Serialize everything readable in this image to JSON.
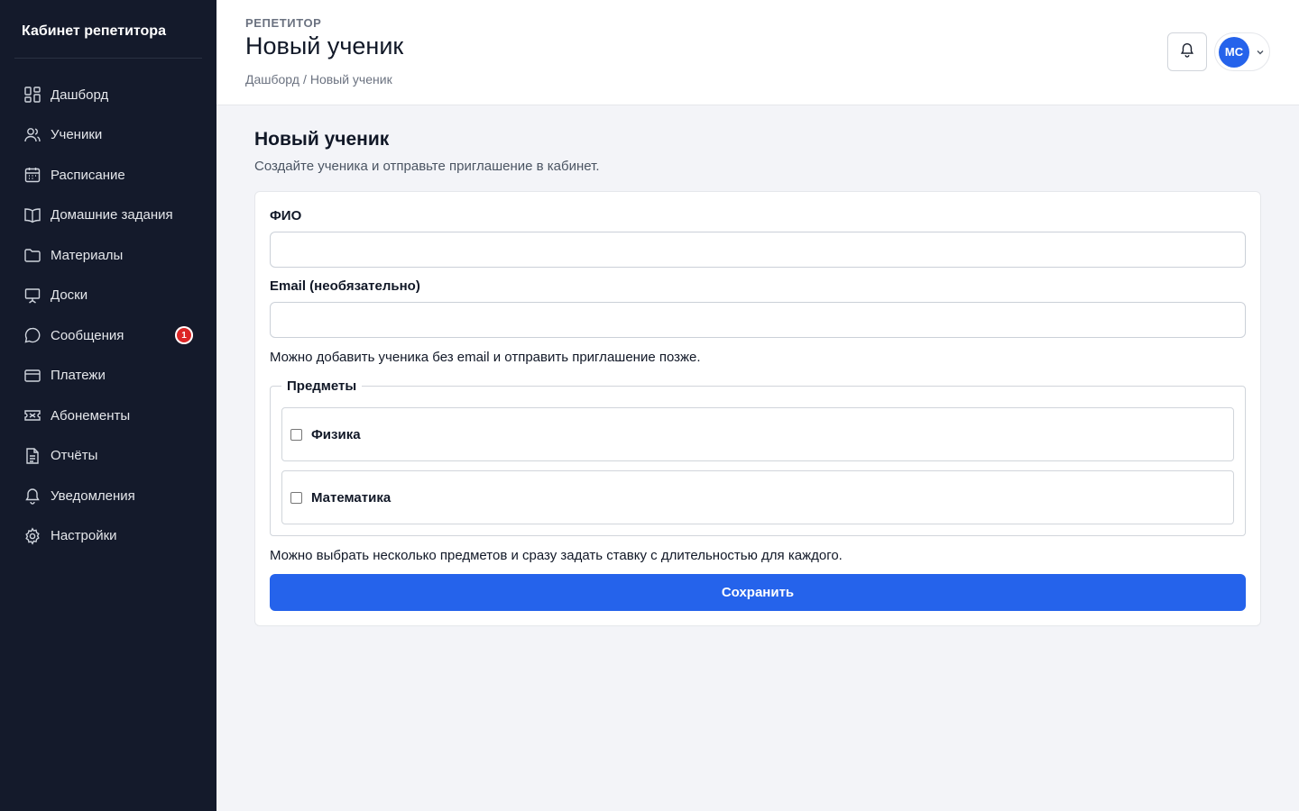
{
  "sidebar": {
    "brand": "Кабинет репетитора",
    "items": [
      {
        "label": "Дашборд",
        "icon": "dashboard-icon"
      },
      {
        "label": "Ученики",
        "icon": "users-icon"
      },
      {
        "label": "Расписание",
        "icon": "calendar-icon"
      },
      {
        "label": "Домашние задания",
        "icon": "book-icon"
      },
      {
        "label": "Материалы",
        "icon": "folder-icon"
      },
      {
        "label": "Доски",
        "icon": "whiteboard-icon"
      },
      {
        "label": "Сообщения",
        "icon": "message-icon",
        "badge": "1"
      },
      {
        "label": "Платежи",
        "icon": "credit-card-icon"
      },
      {
        "label": "Абонементы",
        "icon": "ticket-icon"
      },
      {
        "label": "Отчёты",
        "icon": "report-icon"
      },
      {
        "label": "Уведомления",
        "icon": "bell-icon"
      },
      {
        "label": "Настройки",
        "icon": "gear-icon"
      }
    ]
  },
  "header": {
    "eyebrow": "РЕПЕТИТОР",
    "title": "Новый ученик",
    "breadcrumb": {
      "parent": "Дашборд",
      "separator": "/",
      "current": "Новый ученик"
    },
    "user_initials": "МС"
  },
  "main": {
    "title": "Новый ученик",
    "subtitle": "Создайте ученика и отправьте приглашение в кабинет.",
    "form": {
      "name_label": "ФИО",
      "name_value": "",
      "email_label": "Email (необязательно)",
      "email_value": "",
      "email_help": "Можно добавить ученика без email и отправить приглашение позже.",
      "subjects_legend": "Предметы",
      "subjects": [
        {
          "label": "Физика",
          "checked": false
        },
        {
          "label": "Математика",
          "checked": false
        }
      ],
      "subjects_help": "Можно выбрать несколько предметов и сразу задать ставку с длительностью для каждого.",
      "save_label": "Сохранить"
    }
  },
  "colors": {
    "sidebar_bg": "#141a2b",
    "accent": "#2563eb",
    "badge": "#dc2626"
  }
}
